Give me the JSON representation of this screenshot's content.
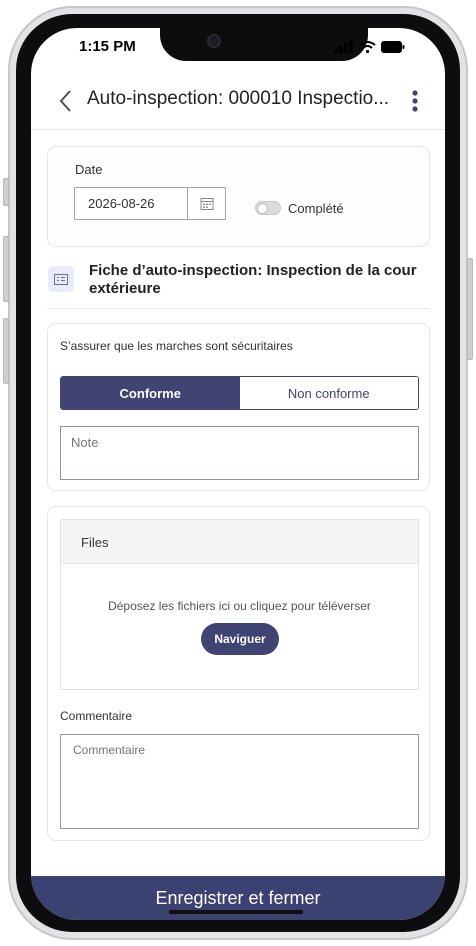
{
  "status_bar": {
    "time": "1:15 PM"
  },
  "header": {
    "title": "Auto-inspection: 000010 Inspectio..."
  },
  "date_section": {
    "date_label": "Date",
    "date_value": "2026-08-26",
    "completed_label": "Complété",
    "completed": false
  },
  "form_sheet": {
    "title": "Fiche d’auto-inspection: Inspection de la cour extérieure"
  },
  "question": {
    "text": "S’assurer que les marches sont sécuritaires",
    "options": [
      "Conforme",
      "Non conforme"
    ],
    "selected": "Conforme",
    "note_placeholder": "Note"
  },
  "files": {
    "header": "Files",
    "drop_text": "Déposez les fichiers ici ou cliquez pour téléverser",
    "browse_label": "Naviguer"
  },
  "comment": {
    "label": "Commentaire",
    "placeholder": "Commentaire"
  },
  "footer": {
    "save_label": "Enregistrer et fermer"
  },
  "colors": {
    "accent": "#3f4473",
    "footer": "#3b4170"
  }
}
